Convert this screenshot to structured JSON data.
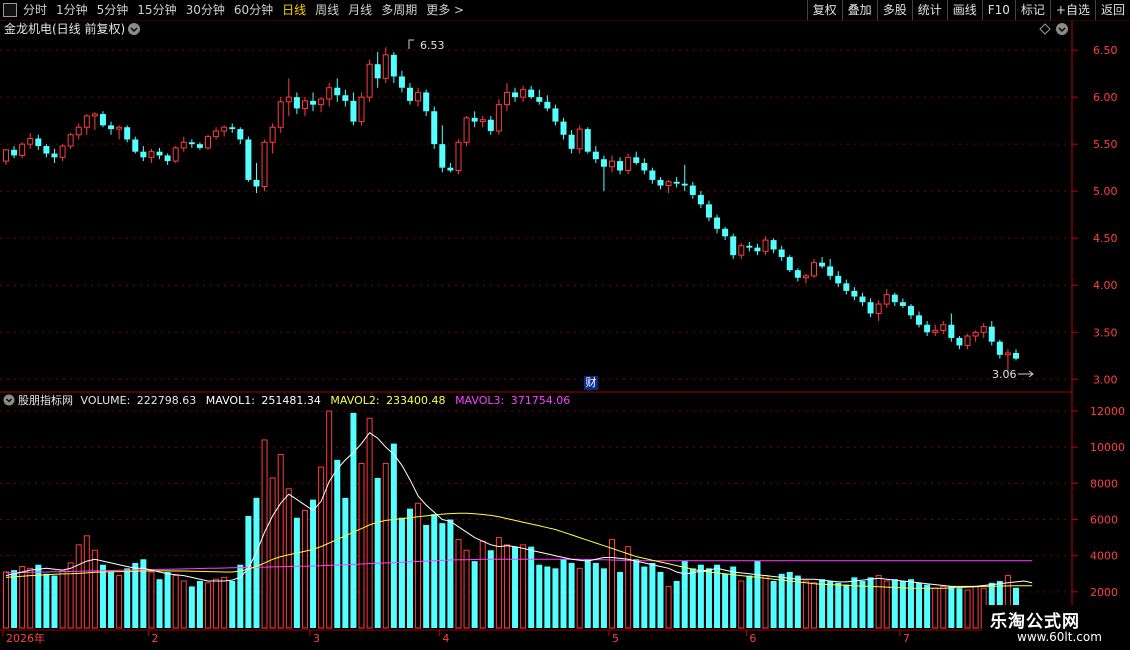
{
  "toolbar": {
    "tabs": [
      "分时",
      "1分钟",
      "5分钟",
      "15分钟",
      "30分钟",
      "60分钟",
      "日线",
      "周线",
      "月线",
      "多周期",
      "更多 >"
    ],
    "active_tab": "日线",
    "right_buttons": [
      "复权",
      "叠加",
      "多股",
      "统计",
      "画线",
      "F10",
      "标记",
      "+自选",
      "返回"
    ]
  },
  "price_pane": {
    "title": "金龙机电(日线 前复权)",
    "high_label": "6.53",
    "low_label": "3.06",
    "finance_badge": "财"
  },
  "volume_pane": {
    "indicator_name": "股朋指标网",
    "volume_label": "VOLUME:",
    "volume_value": "222798.63",
    "mavol1_label": "MAVOL1:",
    "mavol1_value": "251481.34",
    "mavol2_label": "MAVOL2:",
    "mavol2_value": "233400.48",
    "mavol3_label": "MAVOL3:",
    "mavol3_value": "371754.06"
  },
  "x_axis_labels": [
    "2026年",
    "2",
    "3",
    "4",
    "5",
    "6",
    "7"
  ],
  "watermark": {
    "title": "乐淘公式网",
    "url": "www.60lt.com"
  },
  "chart_data": {
    "type": "candlestick",
    "title": "金龙机电(日线 前复权)",
    "price_axis": {
      "ticks": [
        3.0,
        3.5,
        4.0,
        4.5,
        5.0,
        5.5,
        6.0,
        6.5
      ],
      "ylim": [
        2.95,
        6.65
      ]
    },
    "volume_axis": {
      "ticks": [
        2000,
        4000,
        6000,
        8000,
        10000,
        12000
      ],
      "ylim": [
        0,
        12500
      ]
    },
    "colors": {
      "up": "#ff3c3c",
      "down": "#54ffff",
      "mavol1": "#ffffff",
      "mavol2": "#ffff40",
      "mavol3": "#ff40ff",
      "axis": "#c00000"
    },
    "candles": [
      [
        5.32,
        5.44,
        5.28,
        5.44,
        3100
      ],
      [
        5.44,
        5.48,
        5.35,
        5.38,
        3200
      ],
      [
        5.38,
        5.52,
        5.35,
        5.5,
        3400
      ],
      [
        5.5,
        5.62,
        5.45,
        5.56,
        3300
      ],
      [
        5.56,
        5.6,
        5.44,
        5.48,
        3500
      ],
      [
        5.48,
        5.5,
        5.36,
        5.4,
        3000
      ],
      [
        5.4,
        5.45,
        5.3,
        5.36,
        2900
      ],
      [
        5.36,
        5.5,
        5.32,
        5.48,
        3200
      ],
      [
        5.48,
        5.62,
        5.45,
        5.6,
        3600
      ],
      [
        5.6,
        5.72,
        5.55,
        5.68,
        4600
      ],
      [
        5.68,
        5.82,
        5.6,
        5.8,
        5100
      ],
      [
        5.8,
        5.84,
        5.65,
        5.82,
        4300
      ],
      [
        5.82,
        5.85,
        5.68,
        5.7,
        3500
      ],
      [
        5.7,
        5.74,
        5.6,
        5.66,
        3100
      ],
      [
        5.66,
        5.7,
        5.55,
        5.68,
        2900
      ],
      [
        5.68,
        5.7,
        5.52,
        5.55,
        3300
      ],
      [
        5.55,
        5.58,
        5.4,
        5.42,
        3600
      ],
      [
        5.42,
        5.48,
        5.32,
        5.36,
        3800
      ],
      [
        5.36,
        5.45,
        5.3,
        5.42,
        3100
      ],
      [
        5.42,
        5.46,
        5.34,
        5.38,
        2700
      ],
      [
        5.38,
        5.4,
        5.28,
        5.32,
        3100
      ],
      [
        5.32,
        5.48,
        5.3,
        5.46,
        2900
      ],
      [
        5.46,
        5.58,
        5.42,
        5.52,
        2600
      ],
      [
        5.52,
        5.55,
        5.46,
        5.5,
        2300
      ],
      [
        5.5,
        5.52,
        5.44,
        5.46,
        2600
      ],
      [
        5.46,
        5.6,
        5.44,
        5.58,
        2500
      ],
      [
        5.58,
        5.68,
        5.55,
        5.64,
        2700
      ],
      [
        5.64,
        5.7,
        5.58,
        5.68,
        2800
      ],
      [
        5.68,
        5.72,
        5.62,
        5.66,
        2600
      ],
      [
        5.66,
        5.68,
        5.5,
        5.55,
        3500
      ],
      [
        5.55,
        5.58,
        5.1,
        5.12,
        6200
      ],
      [
        5.12,
        5.3,
        4.98,
        5.05,
        7200
      ],
      [
        5.05,
        5.55,
        5.0,
        5.52,
        10400
      ],
      [
        5.52,
        5.72,
        5.4,
        5.68,
        8300
      ],
      [
        5.68,
        6.0,
        5.62,
        5.95,
        9600
      ],
      [
        5.95,
        6.2,
        5.8,
        6.0,
        7700
      ],
      [
        6.0,
        6.05,
        5.82,
        5.88,
        6100
      ],
      [
        5.88,
        6.0,
        5.8,
        5.96,
        6500
      ],
      [
        5.96,
        6.05,
        5.85,
        5.92,
        7100
      ],
      [
        5.92,
        6.0,
        5.84,
        5.98,
        8900
      ],
      [
        5.98,
        6.15,
        5.9,
        6.1,
        12000
      ],
      [
        6.1,
        6.2,
        5.95,
        6.02,
        9300
      ],
      [
        6.02,
        6.08,
        5.9,
        5.96,
        7200
      ],
      [
        5.96,
        6.05,
        5.7,
        5.74,
        11900
      ],
      [
        5.74,
        6.05,
        5.7,
        6.0,
        9100
      ],
      [
        6.0,
        6.4,
        5.95,
        6.35,
        11600
      ],
      [
        6.35,
        6.48,
        6.1,
        6.2,
        8300
      ],
      [
        6.2,
        6.53,
        6.15,
        6.45,
        9100
      ],
      [
        6.45,
        6.48,
        6.15,
        6.22,
        10200
      ],
      [
        6.22,
        6.28,
        6.05,
        6.1,
        6100
      ],
      [
        6.1,
        6.15,
        5.92,
        5.96,
        6600
      ],
      [
        5.96,
        6.1,
        5.9,
        6.05,
        6900
      ],
      [
        6.05,
        6.08,
        5.8,
        5.85,
        5700
      ],
      [
        5.85,
        5.9,
        5.45,
        5.5,
        6300
      ],
      [
        5.5,
        5.7,
        5.2,
        5.25,
        5800
      ],
      [
        5.25,
        5.3,
        5.2,
        5.22,
        6000
      ],
      [
        5.22,
        5.55,
        5.18,
        5.52,
        4900
      ],
      [
        5.52,
        5.8,
        5.48,
        5.78,
        4300
      ],
      [
        5.78,
        5.85,
        5.68,
        5.74,
        3700
      ],
      [
        5.74,
        5.8,
        5.68,
        5.76,
        4800
      ],
      [
        5.76,
        5.8,
        5.6,
        5.64,
        4300
      ],
      [
        5.64,
        5.98,
        5.6,
        5.92,
        5000
      ],
      [
        5.92,
        6.15,
        5.85,
        6.05,
        4600
      ],
      [
        6.05,
        6.1,
        5.95,
        6.0,
        4500
      ],
      [
        6.0,
        6.12,
        5.95,
        6.08,
        4600
      ],
      [
        6.08,
        6.12,
        5.98,
        6.0,
        4500
      ],
      [
        6.0,
        6.08,
        5.92,
        5.95,
        3500
      ],
      [
        5.95,
        6.02,
        5.85,
        5.88,
        3400
      ],
      [
        5.88,
        5.92,
        5.7,
        5.74,
        3300
      ],
      [
        5.74,
        5.78,
        5.55,
        5.6,
        3800
      ],
      [
        5.6,
        5.65,
        5.4,
        5.45,
        3600
      ],
      [
        5.45,
        5.7,
        5.4,
        5.66,
        3300
      ],
      [
        5.66,
        5.68,
        5.4,
        5.42,
        3800
      ],
      [
        5.42,
        5.48,
        5.3,
        5.34,
        3600
      ],
      [
        5.34,
        5.38,
        5.0,
        5.26,
        3300
      ],
      [
        5.26,
        5.38,
        5.2,
        5.32,
        4900
      ],
      [
        5.32,
        5.36,
        5.18,
        5.22,
        3100
      ],
      [
        5.22,
        5.4,
        5.18,
        5.36,
        4500
      ],
      [
        5.36,
        5.42,
        5.28,
        5.3,
        3800
      ],
      [
        5.3,
        5.35,
        5.18,
        5.22,
        3400
      ],
      [
        5.22,
        5.25,
        5.08,
        5.12,
        3600
      ],
      [
        5.12,
        5.15,
        5.02,
        5.06,
        3100
      ],
      [
        5.06,
        5.12,
        4.98,
        5.1,
        2300
      ],
      [
        5.1,
        5.15,
        5.04,
        5.08,
        2600
      ],
      [
        5.08,
        5.28,
        5.0,
        5.06,
        3700
      ],
      [
        5.06,
        5.1,
        4.92,
        4.96,
        3300
      ],
      [
        4.96,
        5.0,
        4.82,
        4.86,
        3500
      ],
      [
        4.86,
        4.9,
        4.68,
        4.72,
        3300
      ],
      [
        4.72,
        4.75,
        4.55,
        4.6,
        3500
      ],
      [
        4.6,
        4.62,
        4.48,
        4.52,
        3000
      ],
      [
        4.52,
        4.55,
        4.28,
        4.32,
        3400
      ],
      [
        4.32,
        4.45,
        4.28,
        4.42,
        2600
      ],
      [
        4.42,
        4.46,
        4.36,
        4.4,
        2900
      ],
      [
        4.4,
        4.44,
        4.32,
        4.36,
        3700
      ],
      [
        4.36,
        4.52,
        4.32,
        4.48,
        2900
      ],
      [
        4.48,
        4.5,
        4.34,
        4.38,
        2600
      ],
      [
        4.38,
        4.42,
        4.26,
        4.3,
        3000
      ],
      [
        4.3,
        4.32,
        4.14,
        4.16,
        3100
      ],
      [
        4.16,
        4.18,
        4.04,
        4.08,
        2900
      ],
      [
        4.08,
        4.12,
        4.02,
        4.1,
        2600
      ],
      [
        4.1,
        4.28,
        4.08,
        4.24,
        2500
      ],
      [
        4.24,
        4.3,
        4.18,
        4.2,
        2700
      ],
      [
        4.2,
        4.28,
        4.06,
        4.1,
        2600
      ],
      [
        4.1,
        4.15,
        3.98,
        4.02,
        2500
      ],
      [
        4.02,
        4.06,
        3.9,
        3.94,
        2400
      ],
      [
        3.94,
        3.98,
        3.84,
        3.88,
        2800
      ],
      [
        3.88,
        3.92,
        3.78,
        3.82,
        2600
      ],
      [
        3.82,
        3.86,
        3.66,
        3.7,
        2800
      ],
      [
        3.7,
        3.84,
        3.62,
        3.8,
        2900
      ],
      [
        3.8,
        3.96,
        3.76,
        3.9,
        2600
      ],
      [
        3.9,
        3.92,
        3.78,
        3.82,
        2700
      ],
      [
        3.82,
        3.86,
        3.76,
        3.78,
        2600
      ],
      [
        3.78,
        3.8,
        3.64,
        3.68,
        2700
      ],
      [
        3.68,
        3.72,
        3.55,
        3.58,
        2500
      ],
      [
        3.58,
        3.62,
        3.46,
        3.5,
        2400
      ],
      [
        3.5,
        3.58,
        3.46,
        3.52,
        2200
      ],
      [
        3.52,
        3.62,
        3.48,
        3.58,
        2300
      ],
      [
        3.58,
        3.7,
        3.4,
        3.44,
        2300
      ],
      [
        3.44,
        3.46,
        3.32,
        3.36,
        2200
      ],
      [
        3.36,
        3.48,
        3.32,
        3.46,
        2100
      ],
      [
        3.46,
        3.52,
        3.4,
        3.5,
        2300
      ],
      [
        3.5,
        3.6,
        3.44,
        3.56,
        2200
      ],
      [
        3.56,
        3.62,
        3.36,
        3.4,
        2500
      ],
      [
        3.4,
        3.42,
        3.22,
        3.26,
        2600
      ],
      [
        3.26,
        3.32,
        3.06,
        3.28,
        2900
      ],
      [
        3.28,
        3.32,
        3.2,
        3.22,
        2227
      ]
    ],
    "mavol1": [
      2900,
      3000,
      3100,
      3200,
      3250,
      3300,
      3250,
      3200,
      3300,
      3500,
      3700,
      3800,
      3700,
      3600,
      3500,
      3400,
      3300,
      3300,
      3200,
      3100,
      3000,
      2950,
      2900,
      2800,
      2700,
      2600,
      2600,
      2600,
      2650,
      2800,
      3300,
      4200,
      5300,
      6200,
      6900,
      7400,
      7100,
      6800,
      6500,
      7000,
      8100,
      8800,
      9300,
      9700,
      10200,
      10800,
      10500,
      10000,
      9600,
      9000,
      8200,
      7300,
      6800,
      6400,
      6000,
      5900,
      5600,
      5300,
      5000,
      4800,
      4600,
      4500,
      4550,
      4500,
      4400,
      4300,
      4200,
      4100,
      4000,
      3900,
      3800,
      3750,
      3700,
      3800,
      3900,
      3900,
      3850,
      3800,
      3700,
      3600,
      3500,
      3400,
      3300,
      3100,
      3000,
      3050,
      3150,
      3200,
      3300,
      3200,
      3100,
      3050,
      3000,
      2950,
      2900,
      2850,
      2800,
      2750,
      2700,
      2700,
      2700,
      2650,
      2600,
      2550,
      2550,
      2600,
      2650,
      2700,
      2750,
      2700,
      2650,
      2600,
      2550,
      2500,
      2450,
      2400,
      2350,
      2300,
      2300,
      2300,
      2300,
      2350,
      2400,
      2450,
      2500,
      2550,
      2600,
      2500
    ],
    "mavol2": [
      2800,
      2830,
      2860,
      2900,
      2920,
      2950,
      2970,
      2990,
      3000,
      3020,
      3050,
      3080,
      3100,
      3110,
      3120,
      3130,
      3140,
      3150,
      3160,
      3160,
      3160,
      3150,
      3150,
      3140,
      3130,
      3120,
      3110,
      3100,
      3100,
      3150,
      3250,
      3400,
      3600,
      3800,
      3950,
      4050,
      4150,
      4250,
      4350,
      4500,
      4700,
      4900,
      5100,
      5300,
      5500,
      5700,
      5850,
      5950,
      6000,
      6050,
      6100,
      6150,
      6200,
      6250,
      6300,
      6330,
      6350,
      6350,
      6320,
      6280,
      6230,
      6150,
      6050,
      5950,
      5850,
      5750,
      5650,
      5550,
      5450,
      5300,
      5150,
      5000,
      4850,
      4700,
      4550,
      4400,
      4250,
      4100,
      3950,
      3850,
      3750,
      3650,
      3550,
      3450,
      3350,
      3250,
      3150,
      3100,
      3050,
      3000,
      2950,
      2900,
      2850,
      2800,
      2750,
      2700,
      2650,
      2600,
      2550,
      2500,
      2450,
      2420,
      2400,
      2380,
      2360,
      2340,
      2320,
      2300,
      2280,
      2260,
      2240,
      2220,
      2200,
      2200,
      2200,
      2200,
      2200,
      2220,
      2240,
      2260,
      2280,
      2300,
      2310,
      2320,
      2330,
      2335,
      2340,
      2334
    ],
    "mavol3": [
      3050,
      3060,
      3070,
      3080,
      3090,
      3100,
      3110,
      3120,
      3130,
      3140,
      3150,
      3160,
      3170,
      3180,
      3190,
      3200,
      3210,
      3220,
      3230,
      3240,
      3250,
      3260,
      3270,
      3280,
      3290,
      3300,
      3310,
      3320,
      3330,
      3340,
      3350,
      3360,
      3370,
      3380,
      3390,
      3400,
      3410,
      3420,
      3430,
      3440,
      3460,
      3480,
      3500,
      3520,
      3540,
      3560,
      3580,
      3600,
      3620,
      3640,
      3660,
      3680,
      3700,
      3720,
      3740,
      3760,
      3770,
      3780,
      3790,
      3800,
      3800,
      3800,
      3800,
      3800,
      3800,
      3800,
      3800,
      3800,
      3800,
      3800,
      3800,
      3800,
      3790,
      3780,
      3770,
      3760,
      3750,
      3740,
      3730,
      3720,
      3720,
      3720,
      3720,
      3720,
      3720,
      3720,
      3720,
      3720,
      3720,
      3720,
      3720,
      3720,
      3720,
      3720,
      3720,
      3720,
      3720,
      3720,
      3720,
      3720,
      3720,
      3720,
      3720,
      3720,
      3720,
      3720,
      3720,
      3720,
      3720,
      3720,
      3720,
      3720,
      3720,
      3720,
      3720,
      3720,
      3720,
      3720,
      3720,
      3720,
      3720,
      3720,
      3720,
      3720,
      3720,
      3720,
      3718,
      3717
    ],
    "x_axis_labels": [
      "2026年",
      "2",
      "3",
      "4",
      "5",
      "6",
      "7"
    ],
    "x_axis_label_index": [
      0,
      18,
      38,
      54,
      75,
      92,
      111
    ]
  }
}
